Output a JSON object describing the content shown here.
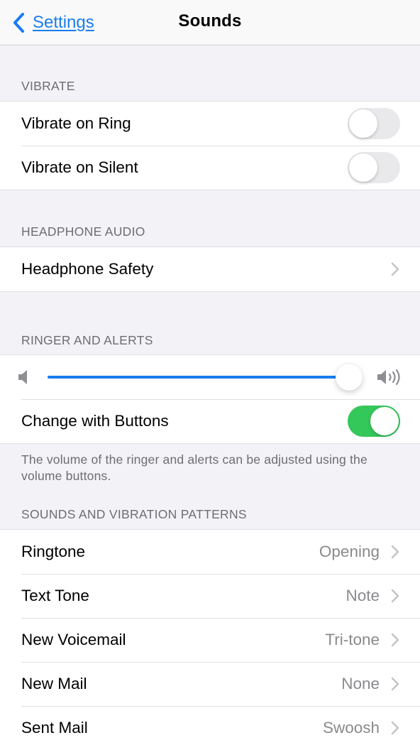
{
  "navbar": {
    "back_label": "Settings",
    "title": "Sounds"
  },
  "sections": {
    "vibrate": {
      "header": "VIBRATE",
      "rows": [
        {
          "label": "Vibrate on Ring",
          "toggle": false
        },
        {
          "label": "Vibrate on Silent",
          "toggle": false
        }
      ]
    },
    "headphone_audio": {
      "header": "HEADPHONE AUDIO",
      "rows": [
        {
          "label": "Headphone Safety"
        }
      ]
    },
    "ringer_and_alerts": {
      "header": "RINGER AND ALERTS",
      "volume_percent": 100,
      "change_with_buttons": {
        "label": "Change with Buttons",
        "toggle": true
      },
      "footer": "The volume of the ringer and alerts can be adjusted using the volume buttons."
    },
    "sounds_patterns": {
      "header": "SOUNDS AND VIBRATION PATTERNS",
      "rows": [
        {
          "label": "Ringtone",
          "value": "Opening"
        },
        {
          "label": "Text Tone",
          "value": "Note"
        },
        {
          "label": "New Voicemail",
          "value": "Tri-tone"
        },
        {
          "label": "New Mail",
          "value": "None"
        },
        {
          "label": "Sent Mail",
          "value": "Swoosh"
        }
      ]
    }
  },
  "colors": {
    "accent": "#1a7cf0",
    "toggle_on": "#34c759",
    "toggle_off": "#e9e9eb",
    "background": "#f2f2f7",
    "secondary_text": "#8a8a8e"
  }
}
